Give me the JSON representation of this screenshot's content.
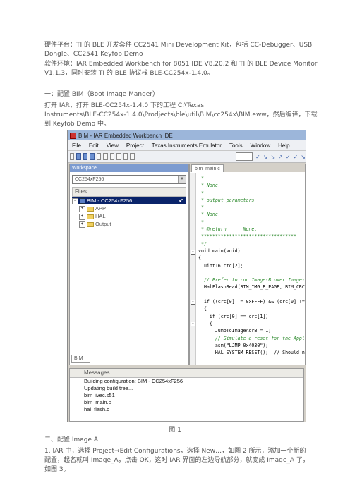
{
  "intro": {
    "line1": "硬件平台：TI 的 BLE 开发套件 CC2541 Mini Development Kit，包括 CC-Debugger、USB",
    "line2": "Dongle、CC2541 Keyfob Demo",
    "line3": "软件环境：IAR Embedded Workbench for 8051 IDE V8.20.2 和 TI 的 BLE Device Monitor",
    "line4": "V1.1.3，同时安装 TI 的 BLE 协议栈 BLE-CC254x-1.4.0。"
  },
  "section1": {
    "heading": "一：配置 BIM（Boot Image Manger）",
    "line1": "打开 IAR，打开 BLE-CC254x-1.4.0 下的工程 C:\\Texas",
    "line2": "Instruments\\BLE-CC254x-1.4.0\\Prodjects\\ble\\util\\BIM\\cc254x\\BIM.eww，然后编译，下载",
    "line3": "到 Keyfob Demo 中。"
  },
  "ide": {
    "title": "BIM - IAR Embedded Workbench IDE",
    "menu": [
      "File",
      "Edit",
      "View",
      "Project",
      "Texas Instruments Emulator",
      "Tools",
      "Window",
      "Help"
    ],
    "workspace": {
      "title": "Workspace",
      "config": "CC254xF256",
      "files_header": "Files",
      "tree": [
        {
          "label": "BIM - CC254xF256",
          "selected": true,
          "check": "✔"
        },
        {
          "label": "APP"
        },
        {
          "label": "HAL"
        },
        {
          "label": "Output"
        }
      ],
      "tab": "BIM"
    },
    "editor": {
      "tab": "bim_main.c",
      "code": [
        " *",
        " * None.",
        " *",
        " * output parameters",
        " *",
        " * None.",
        " *",
        " * @return      None.",
        " **********************************",
        " */",
        "void main(void)",
        "{",
        "  uint16 crc[2];",
        "",
        "  // Prefer to run Image-B over Image-",
        "  HalFlashRead(BIM_IMG_B_PAGE, BIM_CRC",
        "",
        "  if ((crc[0] != 0xFFFF) && (crc[0] !=",
        "  {",
        "    if (crc[0] == crc[1])",
        "    {",
        "      JumpToImageAorB = 1;",
        "      // Simulate a reset for the Appl",
        "      asm(\"LJMP 0x4030\");",
        "      HAL_SYSTEM_RESET();  // Should n"
      ]
    },
    "messages": {
      "header": "Messages",
      "items": [
        "Building configuration: BIM - CC254xF256",
        "Updating build tree...",
        "bim_ivec.s51",
        "bim_main.c",
        "hal_flash.c"
      ]
    }
  },
  "caption1": "图 1",
  "section2": {
    "heading": "二、配置 Image A",
    "line1": "1. IAR 中，选择 Project→Edit Configurations，选择 New…，如图 2 所示，添加一个新的",
    "line2": "配置，起名就叫 Image_A，点击 OK，这时 IAR 界面的左边导航部分，就变成 Image_A 了，",
    "line3": "如图 3。"
  }
}
